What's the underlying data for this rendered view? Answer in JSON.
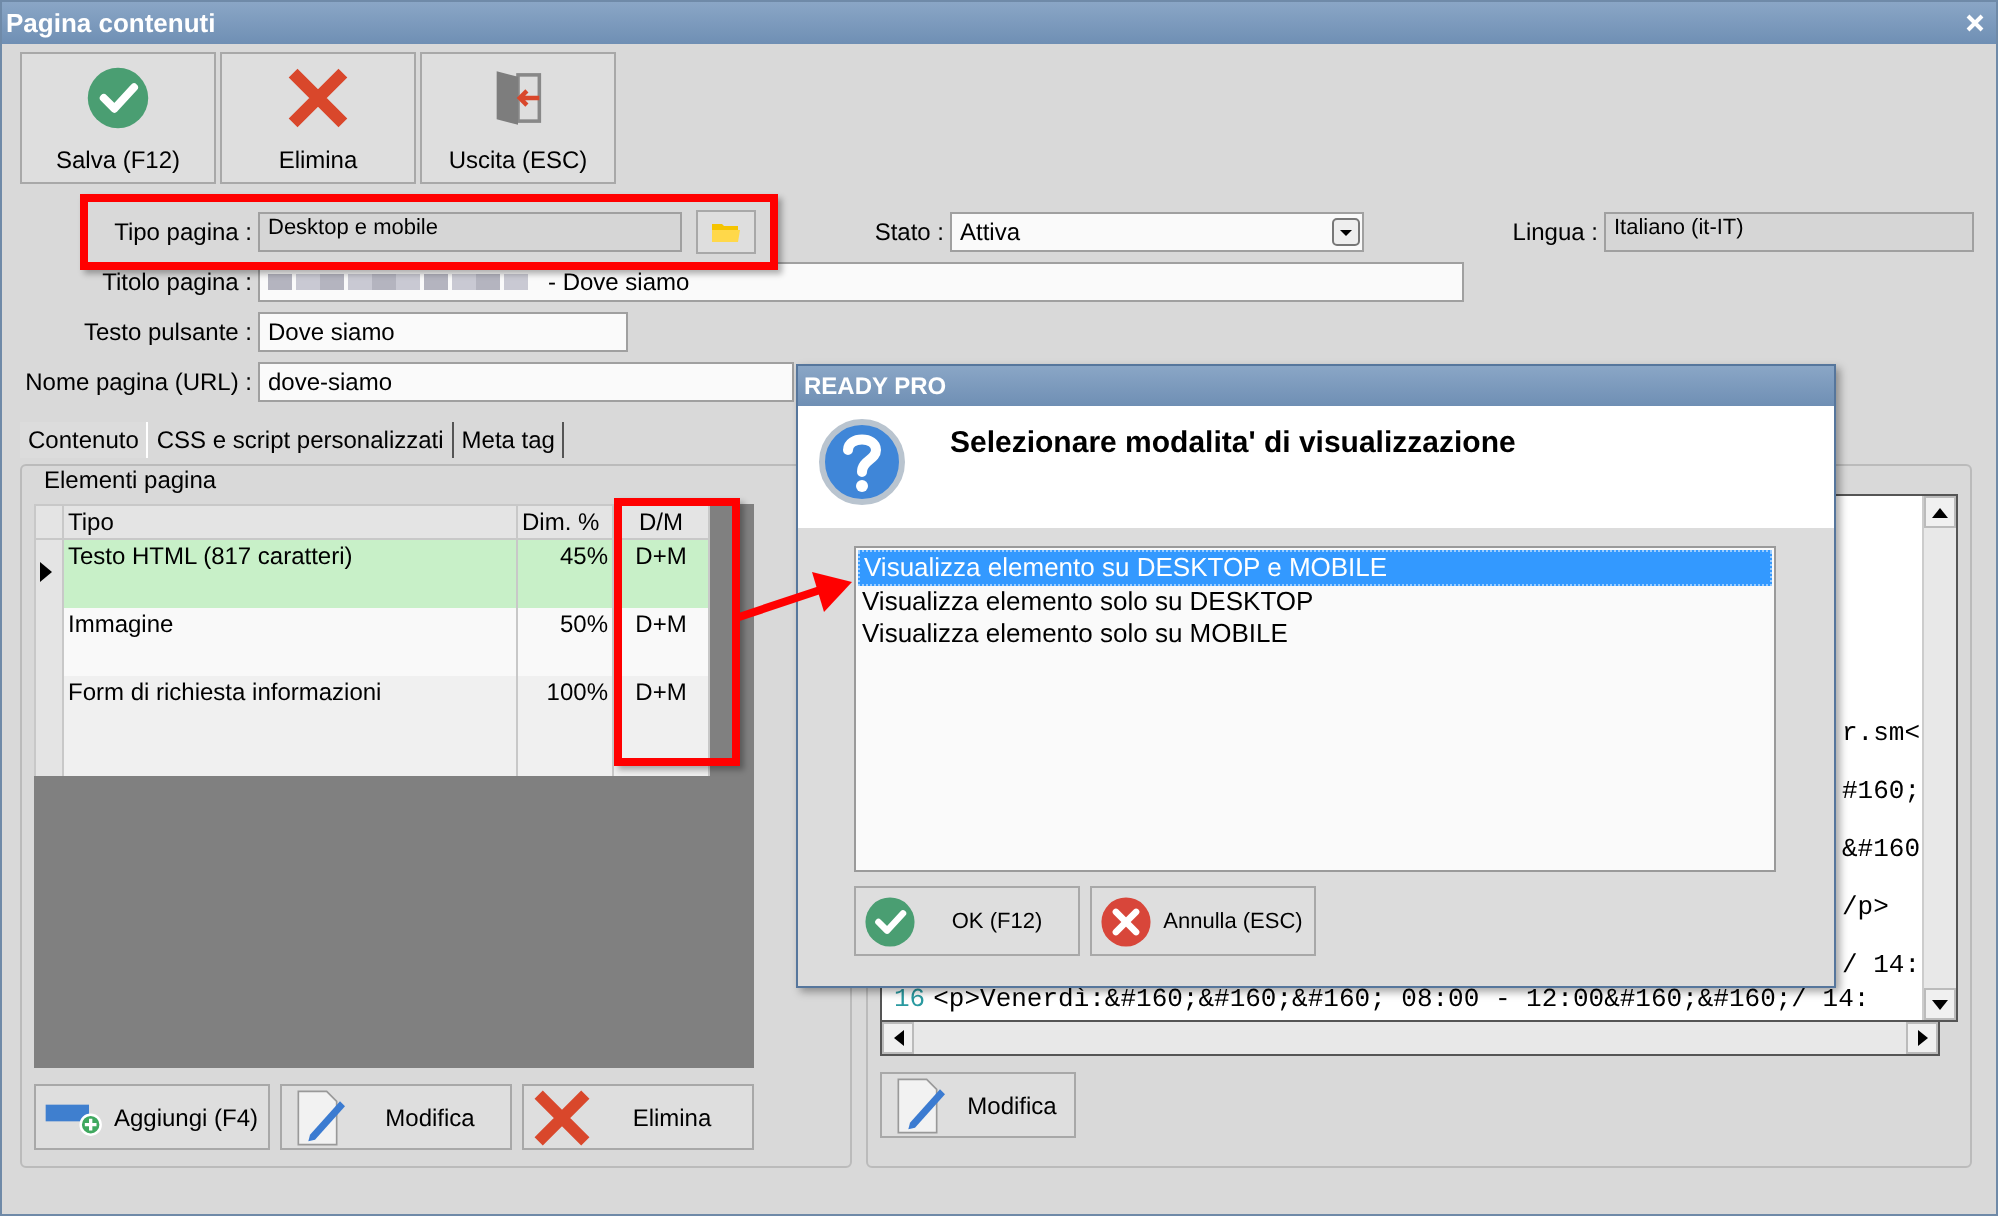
{
  "window": {
    "title": "Pagina contenuti"
  },
  "toolbar": [
    {
      "label": "Salva (F12)",
      "kind": "save"
    },
    {
      "label": "Elimina",
      "kind": "delete"
    },
    {
      "label": "Uscita (ESC)",
      "kind": "exit"
    }
  ],
  "form": {
    "tipo_pagina": {
      "label": "Tipo pagina :",
      "value": "Desktop e mobile"
    },
    "stato": {
      "label": "Stato :",
      "value": "Attiva"
    },
    "lingua": {
      "label": "Lingua :",
      "value": "Italiano (it-IT)"
    },
    "titolo_pagina": {
      "label": "Titolo pagina :",
      "value": "- Dove siamo"
    },
    "testo_pulsante": {
      "label": "Testo pulsante :",
      "value": "Dove siamo"
    },
    "nome_pagina": {
      "label": "Nome pagina (URL) :",
      "value": "dove-siamo"
    }
  },
  "tabs": [
    {
      "label": "Contenuto",
      "selected": true
    },
    {
      "label": "CSS e script personalizzati",
      "selected": false
    },
    {
      "label": "Meta tag",
      "selected": false
    }
  ],
  "elements": {
    "title": "Elementi pagina",
    "columns": [
      "Tipo",
      "Dim. %",
      "D/M"
    ],
    "rows": [
      {
        "tipo": "Testo HTML (817 caratteri)",
        "dim": "45%",
        "dm": "D+M",
        "selected": true
      },
      {
        "tipo": "Immagine",
        "dim": "50%",
        "dm": "D+M",
        "selected": false
      },
      {
        "tipo": "Form di richiesta informazioni",
        "dim": "100%",
        "dm": "D+M",
        "selected": false
      }
    ],
    "buttons": [
      {
        "label": "Aggiungi (F4)",
        "kind": "add"
      },
      {
        "label": "Modifica",
        "kind": "edit"
      },
      {
        "label": "Elimina",
        "kind": "delete"
      }
    ]
  },
  "editor": {
    "lines": [
      {
        "kind": "fragment",
        "text": "r.sm<"
      },
      {
        "kind": "fragment",
        "text": "#160;"
      },
      {
        "kind": "fragment",
        "text": "&#160"
      },
      {
        "kind": "fragment",
        "text": "/p>"
      },
      {
        "kind": "fragment",
        "text": "/ 14:"
      },
      {
        "kind": "numbered",
        "number": "16",
        "text": "<p>Venerdì:&#160;&#160;&#160; 08:00 - 12:00&#160;&#160;/ 14:"
      }
    ],
    "button": {
      "label": "Modifica",
      "kind": "edit"
    }
  },
  "dialog": {
    "title": "READY PRO",
    "message": "Selezionare modalita' di visualizzazione",
    "options": [
      {
        "label": "Visualizza elemento su DESKTOP e MOBILE",
        "selected": true
      },
      {
        "label": "Visualizza elemento solo su DESKTOP",
        "selected": false
      },
      {
        "label": "Visualizza elemento solo su MOBILE",
        "selected": false
      }
    ],
    "buttons": [
      {
        "label": "OK (F12)",
        "kind": "ok"
      },
      {
        "label": "Annulla (ESC)",
        "kind": "cancel"
      }
    ]
  }
}
